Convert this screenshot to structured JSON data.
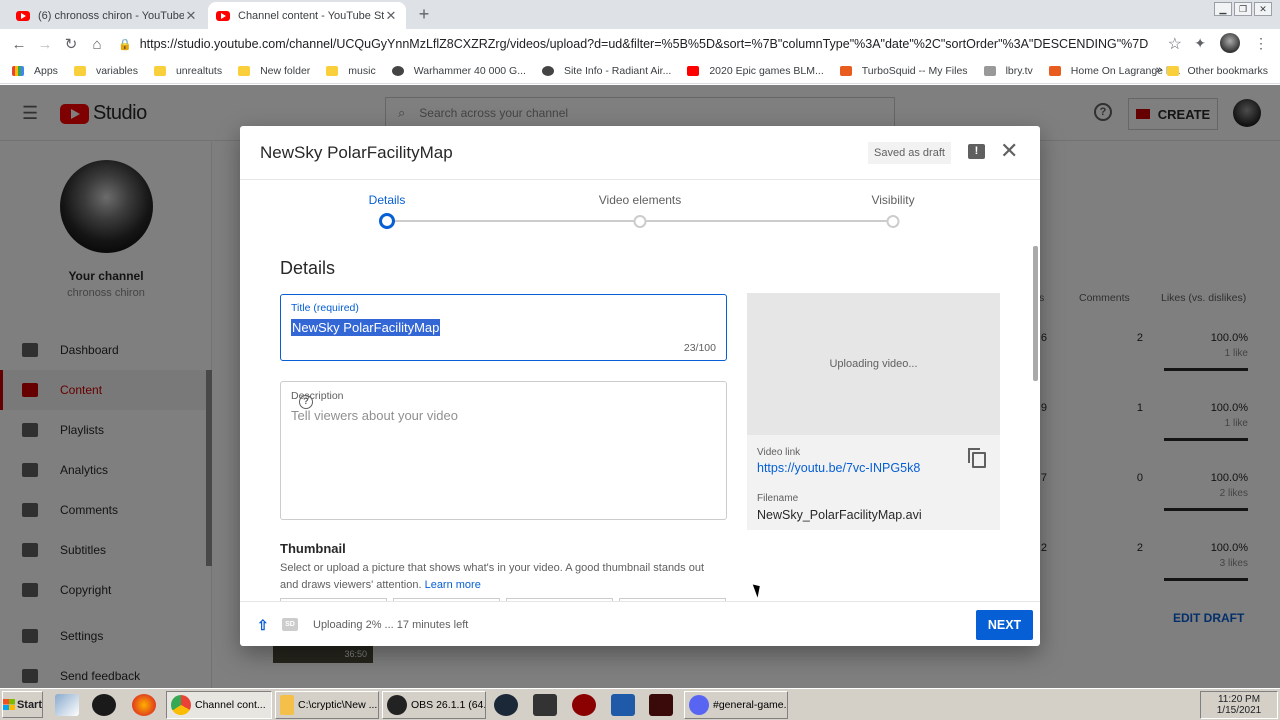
{
  "browser": {
    "tabs": [
      {
        "label": "(6) chronoss chiron - YouTube",
        "active": false
      },
      {
        "label": "Channel content - YouTube Studio",
        "active": true
      }
    ],
    "new_tab": "+",
    "url": "https://studio.youtube.com/channel/UCQuGyYnnMzLflZ8CXZRZrg/videos/upload?d=ud&filter=%5B%5D&sort=%7B\"columnType\"%3A\"date\"%2C\"sortOrder\"%3A\"DESCENDING\"%7D",
    "bookmarks": [
      {
        "label": "Apps",
        "icon": "apps"
      },
      {
        "label": "variables",
        "icon": "folder"
      },
      {
        "label": "unrealtuts",
        "icon": "folder"
      },
      {
        "label": "New folder",
        "icon": "folder"
      },
      {
        "label": "music",
        "icon": "folder"
      },
      {
        "label": "Warhammer 40 000 G...",
        "icon": "dark"
      },
      {
        "label": "Site Info - Radiant Air...",
        "icon": "dark"
      },
      {
        "label": "2020 Epic games BLM...",
        "icon": "red"
      },
      {
        "label": "TurboSquid -- My Files",
        "icon": "orange"
      },
      {
        "label": "lbry.tv",
        "icon": "gray"
      },
      {
        "label": "Home On Lagrange b...",
        "icon": "orange"
      }
    ],
    "bookmarks_more": "»",
    "other_bookmarks": "Other bookmarks"
  },
  "studio": {
    "logo_text": "Studio",
    "search_placeholder": "Search across your channel",
    "create_label": "CREATE",
    "channel": {
      "title": "Your channel",
      "name": "chronoss chiron"
    },
    "nav": [
      {
        "label": "Dashboard",
        "active": false
      },
      {
        "label": "Content",
        "active": true
      },
      {
        "label": "Playlists",
        "active": false
      },
      {
        "label": "Analytics",
        "active": false
      },
      {
        "label": "Comments",
        "active": false
      },
      {
        "label": "Subtitles",
        "active": false
      },
      {
        "label": "Copyright",
        "active": false
      },
      {
        "label": "Settings",
        "active": false
      },
      {
        "label": "Send feedback",
        "active": false
      }
    ],
    "table": {
      "headers": {
        "views": "s",
        "comments": "Comments",
        "likes": "Likes (vs. dislikes)"
      },
      "rows": [
        {
          "views": "6",
          "comments": "2",
          "likes_pct": "100.0%",
          "likes": "1 like"
        },
        {
          "views": "9",
          "comments": "1",
          "likes_pct": "100.0%",
          "likes": "1 like"
        },
        {
          "views": "7",
          "comments": "0",
          "likes_pct": "100.0%",
          "likes": "2 likes"
        },
        {
          "views": "2",
          "comments": "2",
          "likes_pct": "100.0%",
          "likes": "3 likes"
        }
      ],
      "edit_draft": "EDIT DRAFT",
      "thumb_duration": "36:50"
    }
  },
  "modal": {
    "title": "NewSky PolarFacilityMap",
    "saved_badge": "Saved as draft",
    "steps": [
      {
        "label": "Details",
        "active": true
      },
      {
        "label": "Video elements",
        "active": false
      },
      {
        "label": "Visibility",
        "active": false
      }
    ],
    "section_title": "Details",
    "title_field": {
      "label": "Title (required)",
      "value": "NewSky PolarFacilityMap",
      "count": "23/100"
    },
    "description_field": {
      "label": "Description",
      "placeholder": "Tell viewers about your video"
    },
    "thumbnail": {
      "title": "Thumbnail",
      "description": "Select or upload a picture that shows what's in your video. A good thumbnail stands out and draws viewers' attention.",
      "learn_more": "Learn more"
    },
    "preview": {
      "status": "Uploading video...",
      "video_link_label": "Video link",
      "video_link": "https://youtu.be/7vc-INPG5k8",
      "filename_label": "Filename",
      "filename": "NewSky_PolarFacilityMap.avi"
    },
    "footer": {
      "sd_badge": "SD",
      "status": "Uploading 2% ... 17 minutes left",
      "upload_progress_pct": 2,
      "next_label": "NEXT"
    }
  },
  "taskbar": {
    "start_label": "Start",
    "tasks": [
      {
        "label": "Channel cont...",
        "pressed": true
      },
      {
        "label": "C:\\cryptic\\New ...",
        "pressed": false
      },
      {
        "label": "OBS 26.1.1 (64...",
        "pressed": false
      },
      {
        "label": "#general-game...",
        "pressed": false
      }
    ],
    "clock_time": "11:20 PM",
    "clock_date": "1/15/2021"
  }
}
